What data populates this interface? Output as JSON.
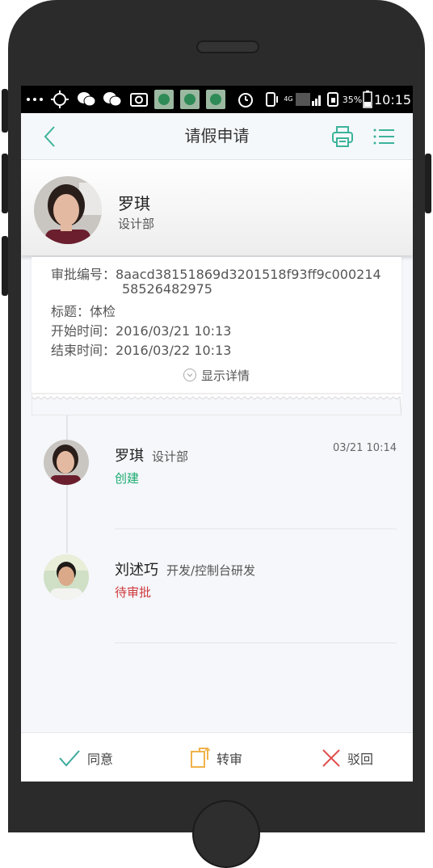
{
  "statusbar": {
    "network": "4G",
    "battery": "35%",
    "time": "10:15"
  },
  "navbar": {
    "title": "请假申请"
  },
  "applicant": {
    "name": "罗琪",
    "dept": "设计部"
  },
  "details": {
    "approval_no_label": "审批编号：",
    "approval_no_line1": "8aacd38151869d3201518f93ff9c000214",
    "approval_no_line2": "58526482975",
    "title_label": "标题：",
    "title_value": "体检",
    "start_label": "开始时间：",
    "start_value": "2016/03/21 10:13",
    "end_label": "结束时间：",
    "end_value": "2016/03/22 10:13",
    "show_detail": "显示详情"
  },
  "timeline": [
    {
      "name": "罗琪",
      "dept": "设计部",
      "time": "03/21 10:14",
      "status": "创建",
      "status_color": "#1aaa6f"
    },
    {
      "name": "刘述巧",
      "dept": "开发/控制台研发",
      "time": "",
      "status": "待审批",
      "status_color": "#d0393b"
    }
  ],
  "actions": {
    "agree": "同意",
    "transfer": "转审",
    "reject": "驳回"
  },
  "colors": {
    "accent": "#3bb39a",
    "agree_icon": "#3aaa9a",
    "transfer_icon": "#f0b24a",
    "reject_icon": "#e05050"
  }
}
